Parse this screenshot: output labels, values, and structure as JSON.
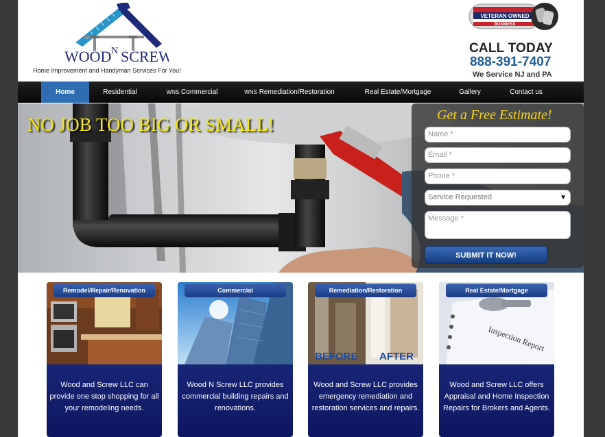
{
  "header": {
    "logo_text_left": "WOOD",
    "logo_text_n": "N",
    "logo_text_right": "SCREW",
    "tagline": "Home Improvement and Handyman Services For You!",
    "badge_line1": "VETERAN OWNED",
    "badge_line2": "BUSINESS",
    "call_today": "CALL TODAY",
    "phone": "888-391-7407",
    "service_area": "We Service NJ and PA"
  },
  "nav": {
    "items": [
      {
        "label": "Home",
        "prefix": ""
      },
      {
        "label": "Residential",
        "prefix": ""
      },
      {
        "label": "Commercial",
        "prefix": "WNS"
      },
      {
        "label": "Remediation/Restoration",
        "prefix": "WNS"
      },
      {
        "label": "Real Estate/Mortgage",
        "prefix": ""
      },
      {
        "label": "Gallery",
        "prefix": ""
      },
      {
        "label": "Contact us",
        "prefix": ""
      }
    ]
  },
  "hero": {
    "headline": "NO JOB TOO BIG OR SMALL!"
  },
  "estimate_form": {
    "title": "Get a Free Estimate!",
    "name_placeholder": "Name *",
    "email_placeholder": "Email *",
    "phone_placeholder": "Phone *",
    "service_selected": "Service Requested",
    "message_placeholder": "Message *",
    "submit_label": "SUBMIT IT NOW!"
  },
  "cards": [
    {
      "tab": "Remodel/Repair/Renovation",
      "text": "Wood and Screw LLC can provide one stop shopping for all your remodeling needs."
    },
    {
      "tab": "Commercial",
      "text": "Wood N Screw LLC provides commercial building repairs and renovations."
    },
    {
      "tab": "Remediation/Restoration",
      "text": "Wood and Screw LLC provides emergency remediation and restoration services and repairs.",
      "img_label_left": "BEFORE",
      "img_label_right": "AFTER"
    },
    {
      "tab": "Real Estate/Mortgage",
      "text": "Wood and Screw LLC offers Appraisal and Home Inspection Repairs for Brokers and Agents.",
      "img_label": "Inspection Report"
    }
  ],
  "colors": {
    "nav_active": "#2f6db3",
    "phone": "#1b5c99",
    "headline": "#f3e61a",
    "card_bg": "#1a2a80"
  }
}
